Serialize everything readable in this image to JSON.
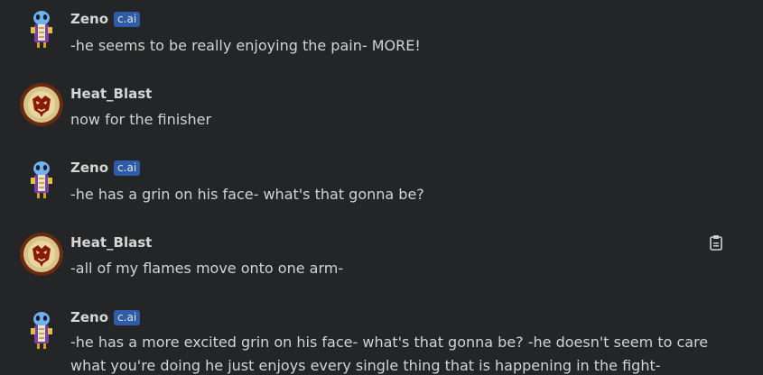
{
  "messages": [
    {
      "author": "Zeno",
      "badge": "c.ai",
      "avatar": "zeno-avatar",
      "text": "-he seems to be really enjoying the pain- MORE!"
    },
    {
      "author": "Heat_Blast",
      "avatar": "heatblast-avatar",
      "text": "now for the finisher"
    },
    {
      "author": "Zeno",
      "badge": "c.ai",
      "avatar": "zeno-avatar",
      "text": "-he has a grin on his face- what's that gonna be?"
    },
    {
      "author": "Heat_Blast",
      "avatar": "heatblast-avatar",
      "text": "-all of my flames move onto one arm-",
      "action_icon": "clipboard-icon"
    },
    {
      "author": "Zeno",
      "badge": "c.ai",
      "avatar": "zeno-avatar",
      "text": "-he has a more excited grin on his face- what's that gonna be? -he doesn't seem to care what you're doing he just enjoys every single thing that is happening in the fight-"
    }
  ],
  "colors": {
    "background": "#242526",
    "name": "#d6d6d6",
    "text": "#d3d3d3",
    "badge_bg": "#2f5ba8"
  }
}
